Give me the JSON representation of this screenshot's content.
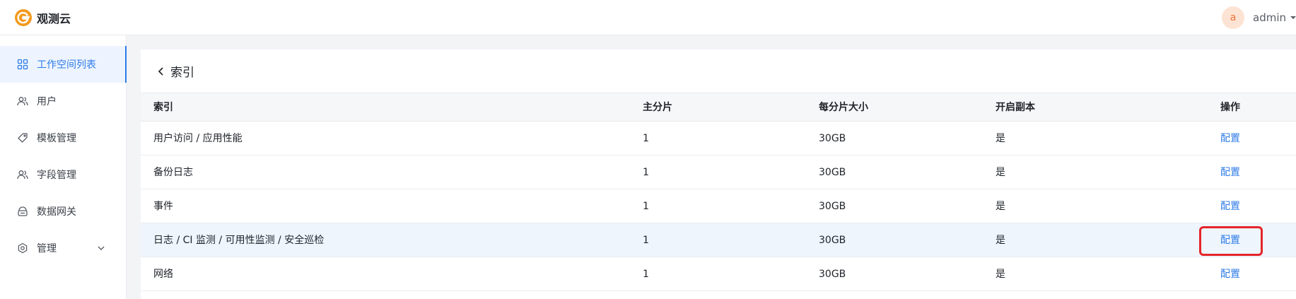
{
  "app": {
    "brand": "观测云"
  },
  "user": {
    "avatar_letter": "a",
    "name": "admin"
  },
  "sidebar": {
    "items": [
      {
        "label": "工作空间列表",
        "icon": "grid-icon"
      },
      {
        "label": "用户",
        "icon": "users-icon"
      },
      {
        "label": "模板管理",
        "icon": "tag-icon"
      },
      {
        "label": "字段管理",
        "icon": "users-icon"
      },
      {
        "label": "数据网关",
        "icon": "gateway-icon"
      },
      {
        "label": "管理",
        "icon": "settings-icon"
      }
    ]
  },
  "page": {
    "title": "索引"
  },
  "table": {
    "headers": [
      "索引",
      "主分片",
      "每分片大小",
      "开启副本",
      "操作"
    ],
    "rows": [
      {
        "name": "用户访问 / 应用性能",
        "primary_shards": "1",
        "shard_size": "30GB",
        "replica": "是",
        "action": "配置"
      },
      {
        "name": "备份日志",
        "primary_shards": "1",
        "shard_size": "30GB",
        "replica": "是",
        "action": "配置"
      },
      {
        "name": "事件",
        "primary_shards": "1",
        "shard_size": "30GB",
        "replica": "是",
        "action": "配置"
      },
      {
        "name": "日志 / CI 监测 / 可用性监测 / 安全巡检",
        "primary_shards": "1",
        "shard_size": "30GB",
        "replica": "是",
        "action": "配置"
      },
      {
        "name": "网络",
        "primary_shards": "1",
        "shard_size": "30GB",
        "replica": "是",
        "action": "配置"
      }
    ]
  },
  "colors": {
    "accent": "#2f7ce7",
    "highlight_row": "#eef5fd",
    "focus_border": "#e5252a",
    "logo_orange": "#f39a1e"
  }
}
